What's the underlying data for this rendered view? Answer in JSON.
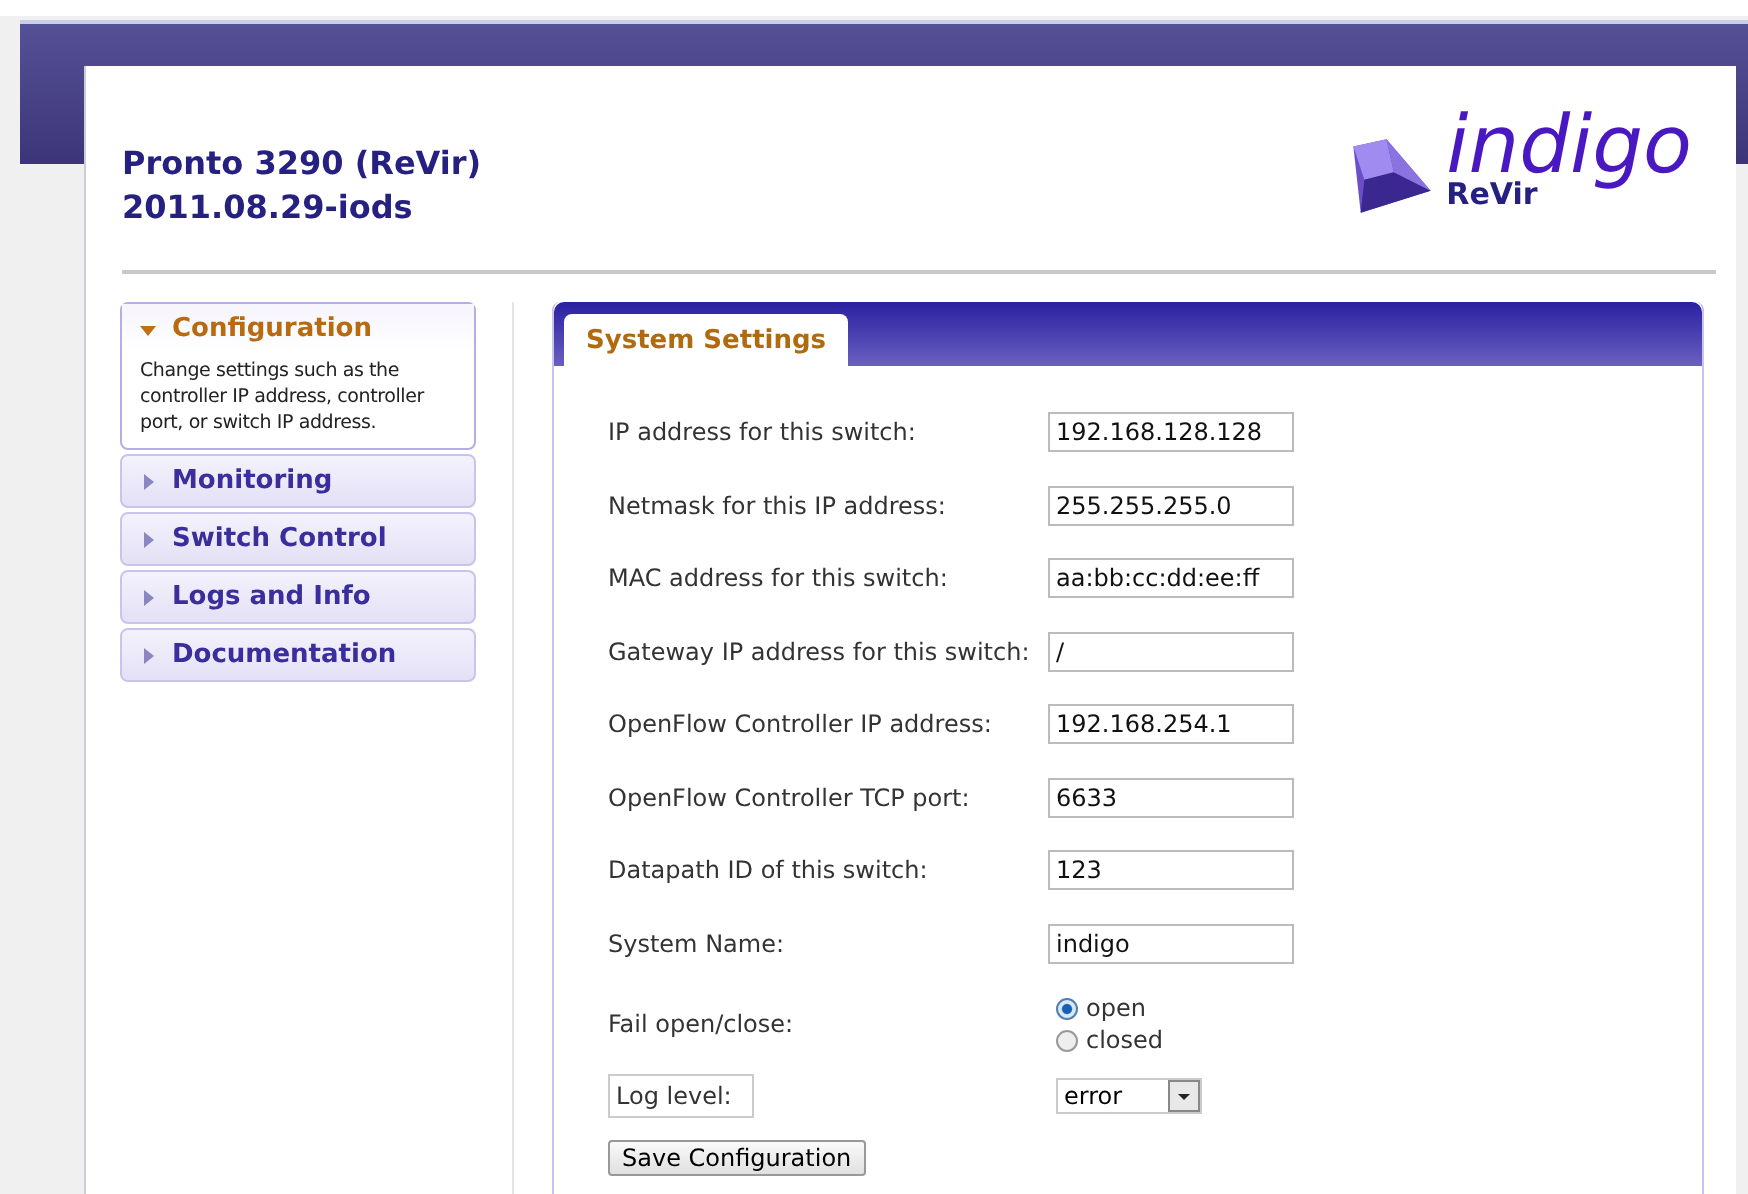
{
  "header": {
    "title": "Pronto 3290 (ReVir)",
    "subtitle": "2011.08.29-iods",
    "logo": {
      "name": "indigo",
      "tagline": "ReVir"
    }
  },
  "sidebar": {
    "items": [
      {
        "label": "Configuration",
        "expanded": true,
        "description": "Change settings such as the controller IP address, controller port, or switch IP address."
      },
      {
        "label": "Monitoring",
        "expanded": false
      },
      {
        "label": "Switch Control",
        "expanded": false
      },
      {
        "label": "Logs and Info",
        "expanded": false
      },
      {
        "label": "Documentation",
        "expanded": false
      }
    ]
  },
  "panel": {
    "tabs": [
      {
        "label": "System Settings",
        "selected": true
      }
    ],
    "fields": [
      {
        "kind": "text",
        "label": "IP address for this switch:",
        "value": "192.168.128.128"
      },
      {
        "kind": "text",
        "label": "Netmask for this IP address:",
        "value": "255.255.255.0"
      },
      {
        "kind": "text",
        "label": "MAC address for this switch:",
        "value": "aa:bb:cc:dd:ee:ff"
      },
      {
        "kind": "text",
        "label": "Gateway IP address for this switch:",
        "value": "/"
      },
      {
        "kind": "text",
        "label": "OpenFlow Controller IP address:",
        "value": "192.168.254.1"
      },
      {
        "kind": "text",
        "label": "OpenFlow Controller TCP port:",
        "value": "6633"
      },
      {
        "kind": "text",
        "label": "Datapath ID of this switch:",
        "value": "123"
      },
      {
        "kind": "text",
        "label": "System Name:",
        "value": "indigo"
      },
      {
        "kind": "radio",
        "label": "Fail open/close:",
        "options": [
          {
            "label": "open",
            "selected": true
          },
          {
            "label": "closed",
            "selected": false
          }
        ]
      },
      {
        "kind": "select",
        "label": "Log level:",
        "value": "error"
      }
    ],
    "save_button": "Save Configuration"
  }
}
